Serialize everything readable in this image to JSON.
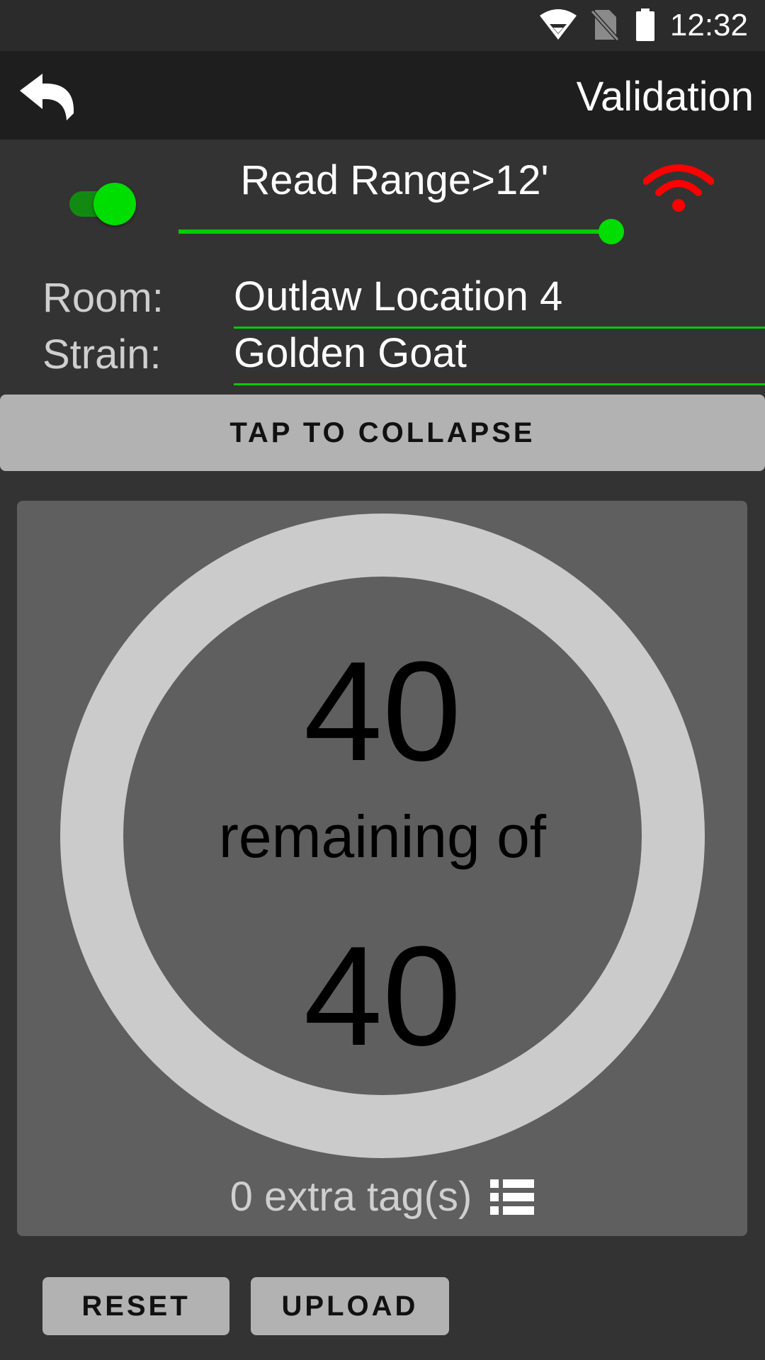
{
  "status_bar": {
    "time": "12:32",
    "icons": [
      "wifi-icon",
      "no-sim-icon",
      "battery-icon"
    ]
  },
  "app_bar": {
    "title": "Validation",
    "back_icon": "back-arrow-icon"
  },
  "reader": {
    "toggle_on": true,
    "range_label": "Read Range>12'",
    "range_level_fraction": 1.0,
    "signal_icon": "wifi-signal-icon",
    "signal_color": "#ff0000"
  },
  "fields": {
    "room_label": "Room:",
    "room_value": "Outlaw Location 4",
    "strain_label": "Strain:",
    "strain_value": "Golden Goat"
  },
  "collapse_label": "TAP TO COLLAPSE",
  "progress": {
    "remaining": "40",
    "separator": "remaining of",
    "total": "40",
    "extra_tags": "0 extra tag(s)",
    "list_icon": "list-icon"
  },
  "actions": {
    "reset_label": "RESET",
    "upload_label": "UPLOAD"
  },
  "colors": {
    "accent": "#00dd00",
    "background": "#333333",
    "card": "#5f5f5f",
    "ring": "#cbcbcb",
    "button": "#b2b2b2"
  }
}
